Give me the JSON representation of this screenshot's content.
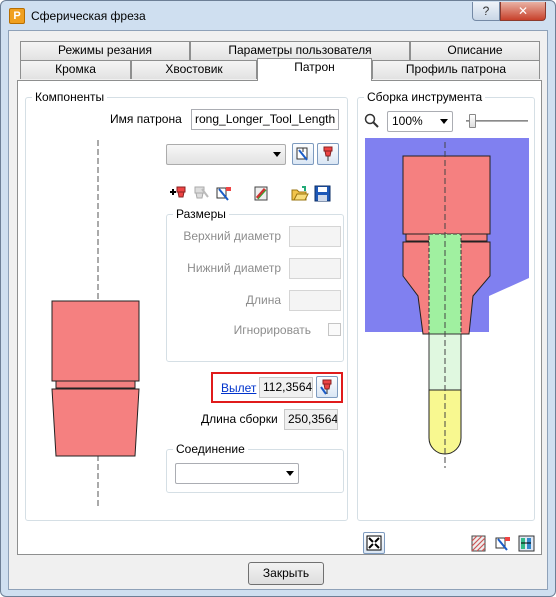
{
  "window": {
    "title": "Сферическая фреза",
    "app_icon_letter": "P",
    "help_label": "?",
    "close_label": "✕"
  },
  "tabs": {
    "row1": [
      "Режимы резания",
      "Параметры пользователя",
      "Описание"
    ],
    "row2": [
      "Кромка",
      "Хвостовик",
      "Патрон",
      "Профиль патрона"
    ],
    "active": "Патрон"
  },
  "components": {
    "group_title": "Компоненты",
    "holder_name_label": "Имя патрона",
    "holder_name_value": "rong_Longer_Tool_Length",
    "component_select_value": ""
  },
  "sizes": {
    "group_title": "Размеры",
    "upper_diameter_label": "Верхний диаметр",
    "lower_diameter_label": "Нижний диаметр",
    "length_label": "Длина",
    "ignore_label": "Игнорировать"
  },
  "overhang": {
    "link_label": "Вылет",
    "value": "112,3564",
    "assembly_length_label": "Длина сборки",
    "assembly_length_value": "250,3564"
  },
  "connection": {
    "group_title": "Соединение",
    "select_value": ""
  },
  "assembly": {
    "group_title": "Сборка инструмента",
    "zoom_value": "100%",
    "zoom_slider_level": 0.05
  },
  "footer": {
    "close_button_label": "Закрыть"
  },
  "colors": {
    "holder_red": "#f58080",
    "gauge_blue": "#8080f0",
    "tool_green": "#a0f0a0",
    "tool_light_green": "#e0f8e0",
    "tool_yellow": "#f8f890",
    "highlight_red": "#e01b1b"
  }
}
